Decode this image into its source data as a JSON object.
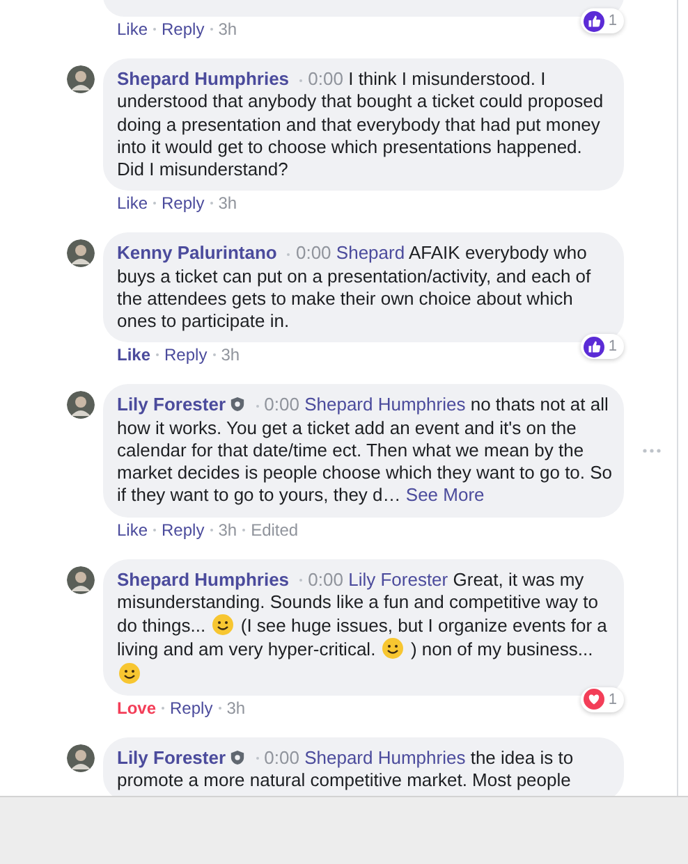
{
  "comments": [
    {
      "actions": {
        "reaction_label": "Like",
        "reacted": false,
        "reply": "Reply",
        "time": "3h"
      },
      "reactions": {
        "kind": "like",
        "count": "1"
      },
      "hover_menu": false
    },
    {
      "author": "Shepard Humphries",
      "moderator": false,
      "time": "0:00",
      "text": "I think I misunderstood. I understood that anybody that bought a ticket could proposed doing a presentation and that everybody that had put money into it would get to choose which presentations happened. Did I misunderstand?",
      "actions": {
        "reaction_label": "Like",
        "reacted": false,
        "reply": "Reply",
        "time": "3h"
      },
      "hover_menu": false
    },
    {
      "author": "Kenny Palurintano",
      "moderator": false,
      "time": "0:00",
      "mention": "Shepard",
      "text": "AFAIK everybody who buys a ticket can put on a presentation/activity, and each of the attendees gets to make their own choice about which ones to participate in.",
      "actions": {
        "reaction_label": "Like",
        "reacted": true,
        "color": "#4b4b9c",
        "reply": "Reply",
        "time": "3h"
      },
      "reactions": {
        "kind": "like",
        "count": "1"
      },
      "hover_menu": false
    },
    {
      "author": "Lily Forester",
      "moderator": true,
      "time": "0:00",
      "mention": "Shepard Humphries",
      "text": "no thats not at all how it works. You get a ticket add an event and it's on the calendar for that date/time ect. Then what we mean by the market decides is people choose which they want to go to. So if they want to go to yours, they d…",
      "see_more": "See More",
      "actions": {
        "reaction_label": "Like",
        "reacted": false,
        "reply": "Reply",
        "time": "3h",
        "edited": "Edited"
      },
      "hover_menu": true
    },
    {
      "author": "Shepard Humphries",
      "moderator": false,
      "time": "0:00",
      "mention": "Lily Forester",
      "parts": [
        {
          "kind": "text",
          "text": "Great, it was my misunderstanding. Sounds like a fun and competitive way to do things..."
        },
        {
          "kind": "emoji"
        },
        {
          "kind": "text",
          "text": "(I see huge issues, but I organize events for a living and am very hyper-critical."
        },
        {
          "kind": "emoji"
        },
        {
          "kind": "text",
          "text": ") non of my business..."
        },
        {
          "kind": "emoji"
        }
      ],
      "actions": {
        "reaction_label": "Love",
        "reacted": true,
        "color": "#f33e58",
        "reply": "Reply",
        "time": "3h"
      },
      "reactions": {
        "kind": "love",
        "count": "1"
      },
      "hover_menu": false
    },
    {
      "author": "Lily Forester",
      "moderator": true,
      "time": "0:00",
      "mention": "Shepard Humphries",
      "text": "the idea is to promote a more natural competitive market. Most people",
      "hover_menu": false
    }
  ]
}
